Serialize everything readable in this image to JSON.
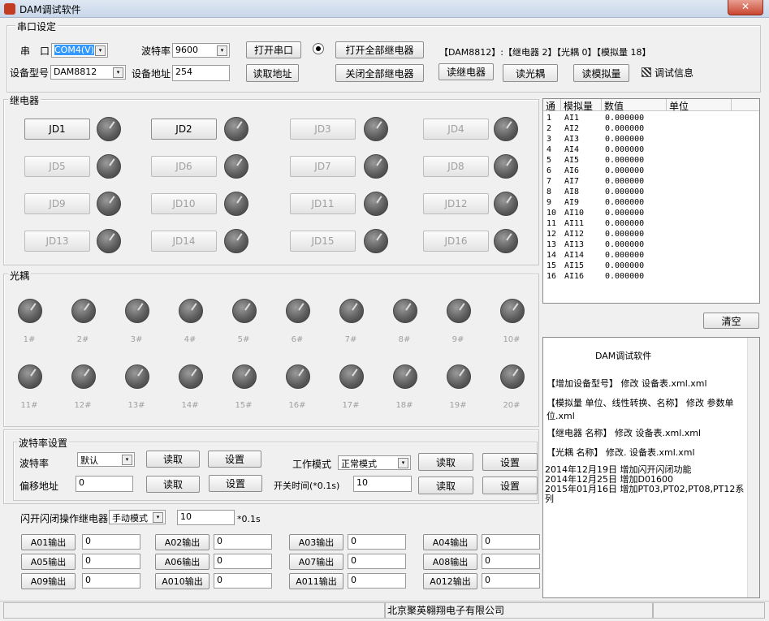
{
  "window": {
    "title": "DAM调试软件",
    "close": "✕"
  },
  "serial": {
    "group_label": "串口设定",
    "port_label": "串　口",
    "port_value": "COM4(V)",
    "baud_label": "波特率",
    "baud_value": "9600",
    "open_btn": "打开串口",
    "open_all_btn": "打开全部继电器",
    "close_all_btn": "关闭全部继电器",
    "model_label": "设备型号",
    "model_value": "DAM8812",
    "addr_label": "设备地址",
    "addr_value": "254",
    "read_addr_btn": "读取地址",
    "device_info": "【DAM8812】:【继电器 2】【光耦 0】【模拟量 18】",
    "read_relay_btn": "读继电器",
    "read_opto_btn": "读光耦",
    "read_analog_btn": "读模拟量",
    "debug_label": "调试信息"
  },
  "relays": {
    "group_label": "继电器",
    "items": [
      "JD1",
      "JD2",
      "JD3",
      "JD4",
      "JD5",
      "JD6",
      "JD7",
      "JD8",
      "JD9",
      "JD10",
      "JD11",
      "JD12",
      "JD13",
      "JD14",
      "JD15",
      "JD16"
    ]
  },
  "optos": {
    "group_label": "光耦",
    "items": [
      "1#",
      "2#",
      "3#",
      "4#",
      "5#",
      "6#",
      "7#",
      "8#",
      "9#",
      "10#",
      "11#",
      "12#",
      "13#",
      "14#",
      "15#",
      "16#",
      "17#",
      "18#",
      "19#",
      "20#"
    ]
  },
  "analog_table": {
    "headers": [
      "通",
      "模拟量",
      "数值",
      "单位"
    ],
    "rows": [
      [
        "1",
        "AI1",
        "0.000000",
        ""
      ],
      [
        "2",
        "AI2",
        "0.000000",
        ""
      ],
      [
        "3",
        "AI3",
        "0.000000",
        ""
      ],
      [
        "4",
        "AI4",
        "0.000000",
        ""
      ],
      [
        "5",
        "AI5",
        "0.000000",
        ""
      ],
      [
        "6",
        "AI6",
        "0.000000",
        ""
      ],
      [
        "7",
        "AI7",
        "0.000000",
        ""
      ],
      [
        "8",
        "AI8",
        "0.000000",
        ""
      ],
      [
        "9",
        "AI9",
        "0.000000",
        ""
      ],
      [
        "10",
        "AI10",
        "0.000000",
        ""
      ],
      [
        "11",
        "AI11",
        "0.000000",
        ""
      ],
      [
        "12",
        "AI12",
        "0.000000",
        ""
      ],
      [
        "13",
        "AI13",
        "0.000000",
        ""
      ],
      [
        "14",
        "AI14",
        "0.000000",
        ""
      ],
      [
        "15",
        "AI15",
        "0.000000",
        ""
      ],
      [
        "16",
        "AI16",
        "0.000000",
        ""
      ]
    ]
  },
  "clear_btn": "清空",
  "log": {
    "title": "DAM调试软件",
    "lines": [
      "【增加设备型号】 修改  设备表.xml.xml",
      "【模拟量 单位、线性转换、名称】 修改 参数单位.xml",
      "【继电器 名称】 修改  设备表.xml.xml",
      "【光耦 名称】 修改. 设备表.xml.xml",
      "2014年12月19日   增加闪开闪闭功能\n2014年12月25日   增加D01600\n2015年01月16日   增加PT03,PT02,PT08,PT12系列"
    ]
  },
  "baud": {
    "group_label": "波特率设置",
    "baud_label": "波特率",
    "baud_value": "默认",
    "read": "读取",
    "set": "设置",
    "offset_label": "偏移地址",
    "offset_value": "0",
    "mode_label": "工作模式",
    "mode_value": "正常模式",
    "switch_label": "开关时间(*0.1s)",
    "switch_value": "10"
  },
  "flash": {
    "label": "闪开闪闭操作继电器",
    "mode_value": "手动模式",
    "time_value": "10",
    "unit": "*0.1s"
  },
  "ao": {
    "items": [
      {
        "label": "A01输出",
        "value": "0"
      },
      {
        "label": "A02输出",
        "value": "0"
      },
      {
        "label": "A03输出",
        "value": "0"
      },
      {
        "label": "A04输出",
        "value": "0"
      },
      {
        "label": "A05输出",
        "value": "0"
      },
      {
        "label": "A06输出",
        "value": "0"
      },
      {
        "label": "A07输出",
        "value": "0"
      },
      {
        "label": "A08输出",
        "value": "0"
      },
      {
        "label": "A09输出",
        "value": "0"
      },
      {
        "label": "A010输出",
        "value": "0"
      },
      {
        "label": "A011输出",
        "value": "0"
      },
      {
        "label": "A012输出",
        "value": "0"
      }
    ]
  },
  "status": {
    "company": "北京聚英翱翔电子有限公司"
  }
}
